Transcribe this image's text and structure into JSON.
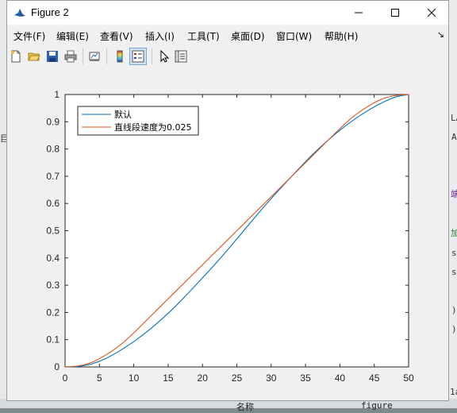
{
  "window": {
    "title": "Figure 2",
    "minimize_symbol": "—",
    "maximize_symbol": "☐",
    "close_symbol": "✕"
  },
  "menu": {
    "items": [
      "文件(F)",
      "编辑(E)",
      "查看(V)",
      "插入(I)",
      "工具(T)",
      "桌面(D)",
      "窗口(W)",
      "帮助(H)"
    ],
    "overflow_symbol": "↘"
  },
  "toolbar": {
    "buttons": [
      "new-figure-icon",
      "open-file-icon",
      "save-icon",
      "print-icon",
      "link-plot-icon",
      "insert-colorbar-icon",
      "insert-legend-icon",
      "edit-plot-icon",
      "property-inspector-icon"
    ],
    "active": "insert-legend-icon"
  },
  "background": {
    "right_glyphs": [
      "LA",
      "A",
      "端",
      "加",
      "s",
      "s:",
      ")",
      ")",
      "1a"
    ],
    "left_glyphs": [
      "目"
    ],
    "bottom_left_text": "名称",
    "bottom_right_text": "figure"
  },
  "chart_data": {
    "type": "line",
    "xlim": [
      0,
      50
    ],
    "ylim": [
      0,
      1
    ],
    "xticks": [
      0,
      5,
      10,
      15,
      20,
      25,
      30,
      35,
      40,
      45,
      50
    ],
    "yticks": [
      0,
      0.1,
      0.2,
      0.3,
      0.4,
      0.5,
      0.6,
      0.7,
      0.8,
      0.9,
      1
    ],
    "xlabel": "",
    "ylabel": "",
    "title": "",
    "grid": false,
    "legend_position": "top-left",
    "series": [
      {
        "name": "默认",
        "color": "#0072bd",
        "x": [
          0,
          2,
          4,
          6,
          8,
          10,
          12,
          14,
          16,
          18,
          20,
          22,
          24,
          26,
          28,
          30,
          32,
          34,
          36,
          38,
          40,
          42,
          44,
          46,
          48,
          50
        ],
        "y": [
          0,
          0.002,
          0.012,
          0.032,
          0.06,
          0.093,
          0.131,
          0.174,
          0.221,
          0.273,
          0.327,
          0.382,
          0.44,
          0.5,
          0.56,
          0.618,
          0.673,
          0.727,
          0.779,
          0.826,
          0.869,
          0.907,
          0.94,
          0.968,
          0.99,
          1
        ]
      },
      {
        "name": "直线段速度为0.025",
        "color": "#d95319",
        "x": [
          0,
          2,
          4,
          6,
          8,
          10,
          12,
          14,
          16,
          18,
          20,
          22,
          24,
          26,
          28,
          30,
          32,
          34,
          36,
          38,
          40,
          42,
          44,
          46,
          48,
          50
        ],
        "y": [
          0,
          0.004,
          0.018,
          0.045,
          0.08,
          0.125,
          0.175,
          0.225,
          0.275,
          0.325,
          0.375,
          0.425,
          0.475,
          0.525,
          0.575,
          0.625,
          0.675,
          0.725,
          0.775,
          0.825,
          0.875,
          0.92,
          0.955,
          0.982,
          0.996,
          1
        ]
      }
    ]
  }
}
